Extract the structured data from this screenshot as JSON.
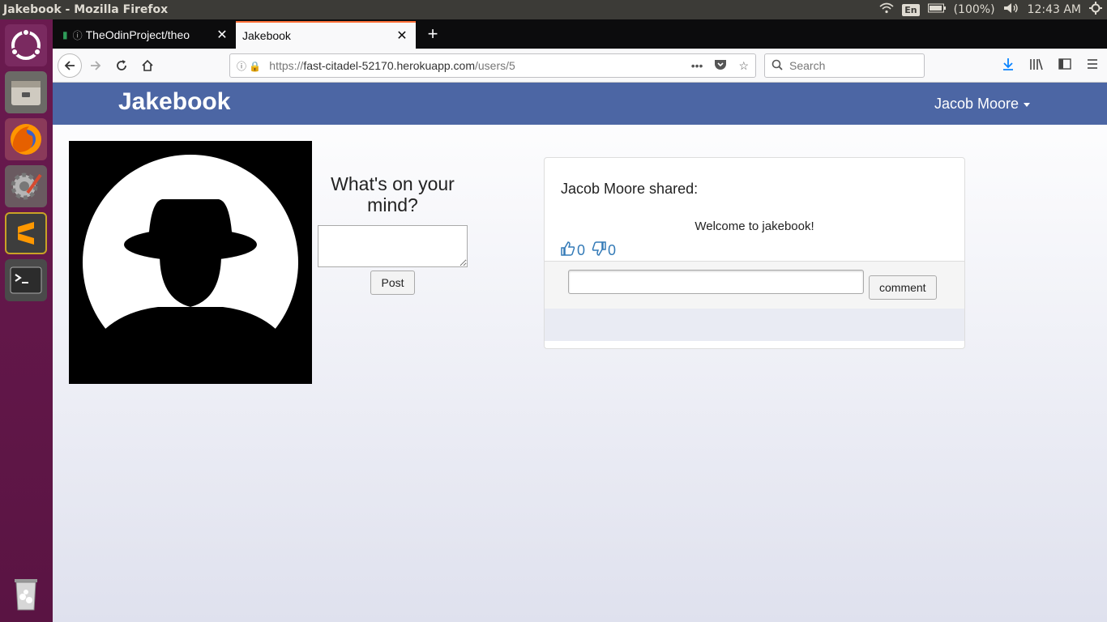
{
  "system": {
    "window_title": "Jakebook - Mozilla Firefox",
    "language": "En",
    "battery": "(100%)",
    "clock": "12:43 AM"
  },
  "launcher": {
    "items": [
      "ubuntu-logo",
      "files",
      "firefox",
      "system-settings",
      "sublime-text",
      "terminal",
      "trash"
    ]
  },
  "browser": {
    "tabs": [
      {
        "label": "TheOdinProject/theo",
        "active": false
      },
      {
        "label": "Jakebook",
        "active": true
      }
    ],
    "url": {
      "scheme": "https://",
      "host": "fast-citadel-52170.herokuapp.com",
      "path": "/users/5"
    },
    "search_placeholder": "Search"
  },
  "page": {
    "brand": "Jakebook",
    "user_menu": "Jacob Moore",
    "composer": {
      "heading": "What's on your mind?",
      "button": "Post"
    },
    "post": {
      "author_line": "Jacob Moore shared:",
      "body": "Welcome to jakebook!",
      "likes": "0",
      "dislikes": "0",
      "comment_button": "comment"
    }
  }
}
